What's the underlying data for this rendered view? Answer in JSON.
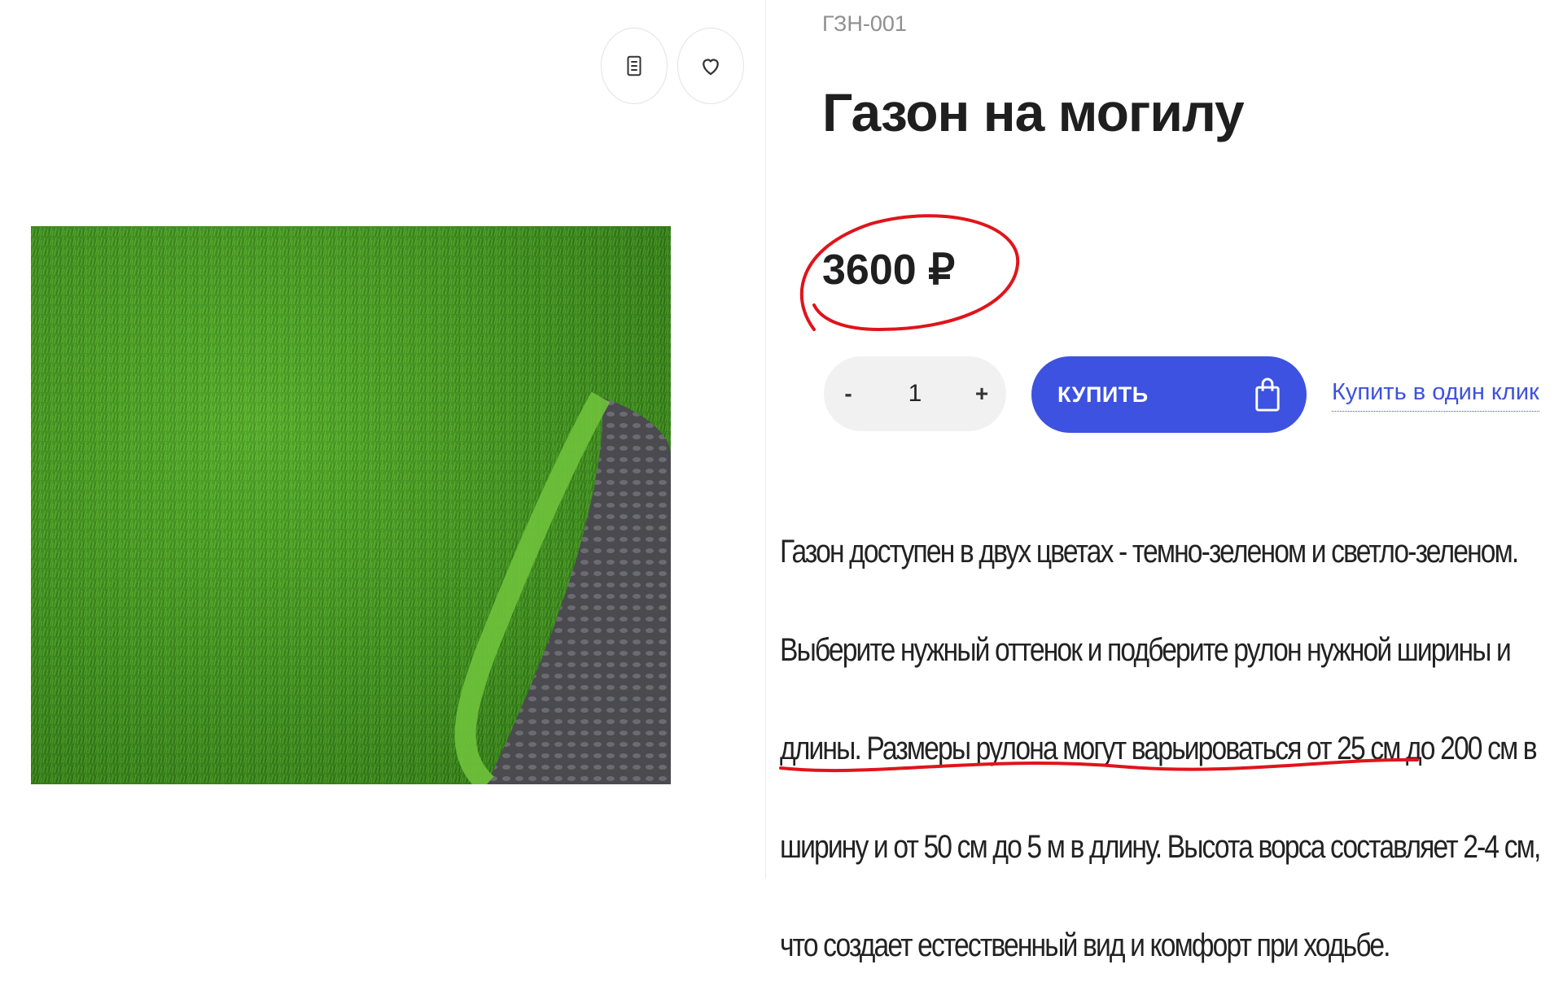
{
  "product": {
    "sku": "ГЗН-001",
    "title": "Газон на могилу",
    "price": "3600 ₽",
    "quantity": "1",
    "qty_minus": "-",
    "qty_plus": "+",
    "buy_label": "КУПИТЬ",
    "one_click_label": "Купить в один клик",
    "description_part1": "Газон доступен в двух цветах - темно-зеленом и светло-зеленом. Выберите нужный оттенок и подберите рулон нужной ширины и длины. Размеры рулона могут ",
    "description_highlight": "варьироваться от 25 см до 200 см в ширину и от 50 см до 5 м в длину",
    "description_part2": ". Высота ворса составляет 2-4 см, что создает естественный вид и комфорт при ходьбе."
  },
  "icons": {
    "compare": "compare-list-icon",
    "favorite": "heart-icon",
    "cart": "shopping-bag-icon"
  },
  "colors": {
    "accent": "#3d52e0",
    "annotation": "#e0141b"
  }
}
